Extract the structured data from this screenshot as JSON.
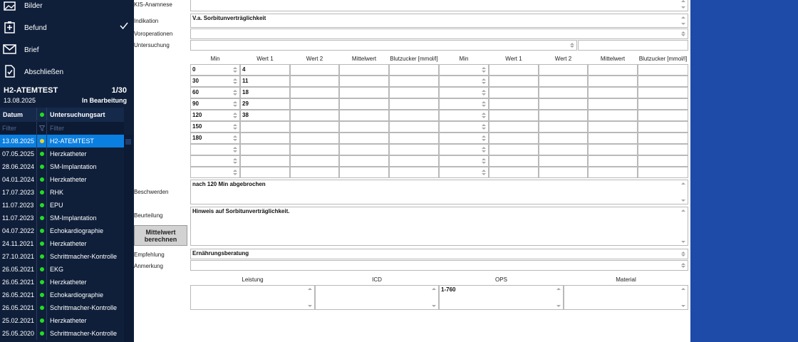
{
  "sidebar": {
    "nav": [
      {
        "label": "Bilder",
        "icon": "image-icon",
        "checked": false
      },
      {
        "label": "Befund",
        "icon": "medical-kit-icon",
        "checked": true
      },
      {
        "label": "Brief",
        "icon": "envelope-icon",
        "checked": false
      },
      {
        "label": "Abschließen",
        "icon": "document-check-icon",
        "checked": false
      }
    ],
    "case": {
      "title": "H2-ATEMTEST",
      "count": "1/30",
      "date": "13.08.2025",
      "status": "In Bearbeitung"
    },
    "grid": {
      "headers": {
        "date": "Datum",
        "type": "Untersuchungsart"
      },
      "filter_placeholder": "Filter",
      "rows": [
        {
          "date": "13.08.2025",
          "type": "H2-ATEMTEST",
          "selected": true
        },
        {
          "date": "07.05.2025",
          "type": "Herzkatheter"
        },
        {
          "date": "28.06.2024",
          "type": "SM-Implantation"
        },
        {
          "date": "04.01.2024",
          "type": "Herzkatheter"
        },
        {
          "date": "17.07.2023",
          "type": "RHK"
        },
        {
          "date": "11.07.2023",
          "type": "EPU"
        },
        {
          "date": "11.07.2023",
          "type": "SM-Implantation"
        },
        {
          "date": "04.07.2022",
          "type": "Echokardiographie"
        },
        {
          "date": "24.11.2021",
          "type": "Herzkatheter"
        },
        {
          "date": "27.10.2021",
          "type": "Schrittmacher-Kontrolle"
        },
        {
          "date": "26.05.2021",
          "type": "EKG"
        },
        {
          "date": "26.05.2021",
          "type": "Herzkatheter"
        },
        {
          "date": "26.05.2021",
          "type": "Echokardiographie"
        },
        {
          "date": "26.05.2021",
          "type": "Schrittmacher-Kontrolle"
        },
        {
          "date": "25.02.2021",
          "type": "Herzkatheter"
        },
        {
          "date": "25.05.2020",
          "type": "Schrittmacher-Kontrolle"
        }
      ]
    }
  },
  "form": {
    "labels": {
      "kis": "KIS-Anamnese",
      "indikation": "Indikation",
      "vorop": "Voroperationen",
      "untersuchung": "Untersuchung",
      "beschwerden": "Beschwerden",
      "beurteilung": "Beurteilung",
      "empfehlung": "Empfehlung",
      "anmerkung": "Anmerkung"
    },
    "values": {
      "kis": "",
      "indikation": "V.a. Sorbitunverträglichkeit",
      "vorop": "",
      "untersuchung": "",
      "beschwerden": "nach 120 Min abgebrochen",
      "beurteilung": "Hinweis auf Sorbitunverträglichkeit.",
      "empfehlung": "Ernährungsberatung",
      "anmerkung": ""
    },
    "table": {
      "headers": [
        "Min",
        "Wert 1",
        "Wert 2",
        "Mittelwert",
        "Blutzucker [mmol/l]",
        "Min",
        "Wert 1",
        "Wert 2",
        "Mittelwert",
        "Blutzucker [mmol/l]"
      ],
      "rows": [
        [
          "0",
          "4"
        ],
        [
          "30",
          "11"
        ],
        [
          "60",
          "18"
        ],
        [
          "90",
          "29"
        ],
        [
          "120",
          "38"
        ],
        [
          "150",
          ""
        ],
        [
          "180",
          ""
        ],
        [
          "",
          ""
        ],
        [
          "",
          ""
        ],
        [
          "",
          ""
        ]
      ]
    },
    "calc_button": "Mittelwert berechnen",
    "bottom": {
      "headers": [
        "Leistung",
        "ICD",
        "OPS",
        "Material"
      ],
      "values": [
        "",
        "",
        "1-760",
        ""
      ]
    }
  }
}
